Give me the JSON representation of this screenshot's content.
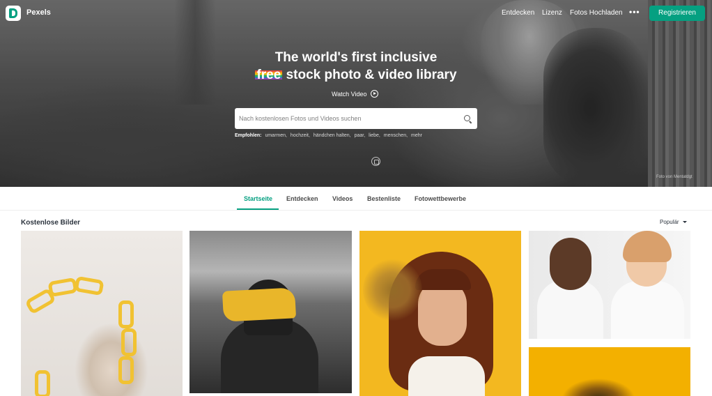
{
  "brand": {
    "name": "Pexels"
  },
  "nav": {
    "links": [
      "Entdecken",
      "Lizenz",
      "Fotos Hochladen"
    ],
    "more": "•••",
    "signup": "Registrieren"
  },
  "hero": {
    "headline_line1": "The world's first inclusive",
    "headline_free": "free",
    "headline_line2_rest": " stock photo & video library",
    "watch_video": "Watch Video",
    "search_placeholder": "Nach kostenlosen Fotos und Videos suchen",
    "suggestions_label": "Empfohlen:",
    "suggestions": [
      "umarmen,",
      "hochzeit,",
      "händchen halten,",
      "paar,",
      "liebe,",
      "menschen,",
      "mehr"
    ],
    "photographer": "Foto von Mentatdgt"
  },
  "tabs": [
    "Startseite",
    "Entdecken",
    "Videos",
    "Bestenliste",
    "Fotowettbewerbe"
  ],
  "active_tab": "Startseite",
  "section": {
    "title": "Kostenlose Bilder",
    "sort": "Populär"
  },
  "colors": {
    "accent": "#05a081",
    "text": "#2c343e"
  }
}
